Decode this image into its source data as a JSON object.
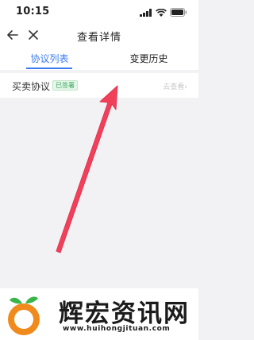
{
  "status_bar": {
    "time": "10:15"
  },
  "nav": {
    "title": "查看详情"
  },
  "tabs": [
    {
      "label": "协议列表",
      "active": true
    },
    {
      "label": "变更历史",
      "active": false
    }
  ],
  "agreement_row": {
    "title": "买卖协议",
    "badge": "已签署",
    "link": "去查看›"
  },
  "colors": {
    "accent": "#3b7bf0",
    "badge_green": "#3aa55b",
    "arrow": "#f0405a"
  },
  "watermark": {
    "title": "辉宏资讯网",
    "url": "www.huihongjituan.com"
  }
}
